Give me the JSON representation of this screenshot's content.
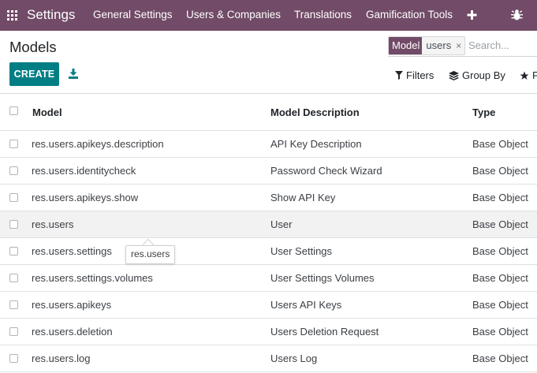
{
  "navbar": {
    "brand": "Settings",
    "menus": [
      "General Settings",
      "Users & Companies",
      "Translations",
      "Gamification Tools"
    ],
    "icons": {
      "apps": "apps-grid-icon",
      "plus": "plus-icon",
      "debug": "bug-icon"
    }
  },
  "control_panel": {
    "title": "Models",
    "create_label": "CREATE",
    "search": {
      "facet_label": "Model",
      "facet_value": "users",
      "facet_remove": "×",
      "placeholder": "Search..."
    },
    "filters_label": "Filters",
    "group_by_label": "Group By",
    "favorites_label": "F"
  },
  "table": {
    "columns": [
      "Model",
      "Model Description",
      "Type"
    ],
    "rows": [
      {
        "model": "res.users.apikeys.description",
        "description": "API Key Description",
        "type": "Base Object"
      },
      {
        "model": "res.users.identitycheck",
        "description": "Password Check Wizard",
        "type": "Base Object"
      },
      {
        "model": "res.users.apikeys.show",
        "description": "Show API Key",
        "type": "Base Object"
      },
      {
        "model": "res.users",
        "description": "User",
        "type": "Base Object"
      },
      {
        "model": "res.users.settings",
        "description": "User Settings",
        "type": "Base Object"
      },
      {
        "model": "res.users.settings.volumes",
        "description": "User Settings Volumes",
        "type": "Base Object"
      },
      {
        "model": "res.users.apikeys",
        "description": "Users API Keys",
        "type": "Base Object"
      },
      {
        "model": "res.users.deletion",
        "description": "Users Deletion Request",
        "type": "Base Object"
      },
      {
        "model": "res.users.log",
        "description": "Users Log",
        "type": "Base Object"
      }
    ]
  },
  "tooltip": {
    "text": "res.users"
  },
  "colors": {
    "navbar": "#714B67",
    "primary": "#017E84",
    "row_hover": "#f2f2f2"
  }
}
